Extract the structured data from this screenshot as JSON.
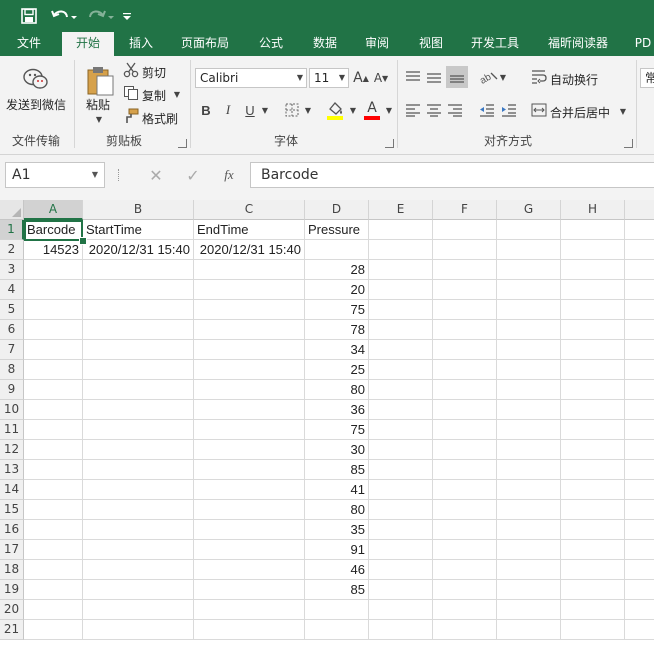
{
  "tabs": [
    "文件",
    "开始",
    "插入",
    "页面布局",
    "公式",
    "数据",
    "审阅",
    "视图",
    "开发工具",
    "福昕阅读器",
    "PD"
  ],
  "active_tab": "开始",
  "ribbon": {
    "file_transfer": {
      "send_wechat": "发送到微信",
      "group_label": "文件传输"
    },
    "clipboard": {
      "paste": "粘贴",
      "cut": "剪切",
      "copy": "复制",
      "format_painter": "格式刷",
      "group_label": "剪贴板"
    },
    "font": {
      "font_name": "Calibri",
      "font_size": "11",
      "bold": "B",
      "italic": "I",
      "underline": "U",
      "grow": "A",
      "shrink": "A",
      "font_color": "A",
      "group_label": "字体"
    },
    "alignment": {
      "wrap_text": "自动换行",
      "merge_center": "合并后居中",
      "group_label": "对齐方式"
    },
    "number": {
      "format": "常"
    }
  },
  "formula_bar": {
    "name_box": "A1",
    "fx": "fx",
    "value": "Barcode"
  },
  "columns": [
    "A",
    "B",
    "C",
    "D",
    "E",
    "F",
    "G",
    "H"
  ],
  "rows": [
    "1",
    "2",
    "3",
    "4",
    "5",
    "6",
    "7",
    "8",
    "9",
    "10",
    "11",
    "12",
    "13",
    "14",
    "15",
    "16",
    "17",
    "18",
    "19",
    "20",
    "21"
  ],
  "cells": {
    "header": [
      "Barcode",
      "StartTime",
      "EndTime",
      "Pressure"
    ],
    "row2": {
      "barcode": "14523",
      "start": "2020/12/31 15:40",
      "end": "2020/12/31 15:40"
    },
    "pressure": [
      "28",
      "20",
      "75",
      "78",
      "34",
      "25",
      "80",
      "36",
      "75",
      "30",
      "85",
      "41",
      "80",
      "35",
      "91",
      "46",
      "85"
    ]
  },
  "colors": {
    "accent": "#217346"
  }
}
